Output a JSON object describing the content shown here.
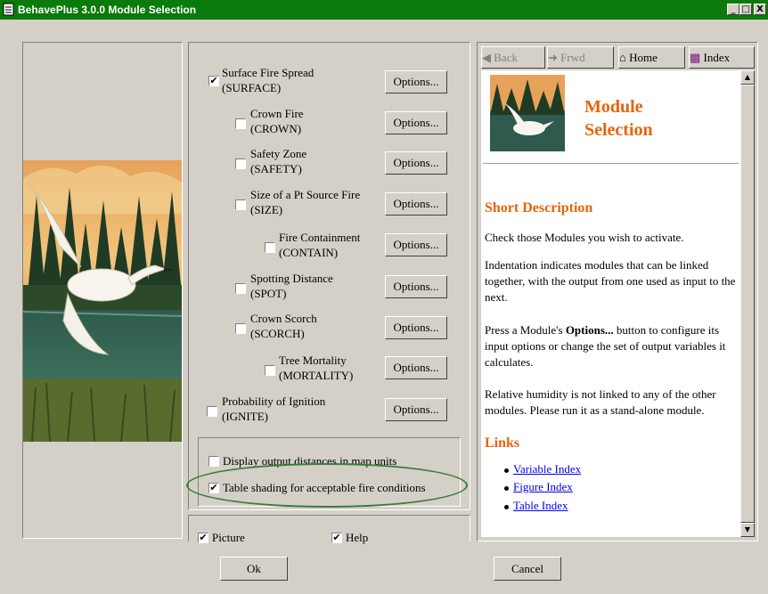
{
  "window": {
    "title": "BehavePlus 3.0.0 Module Selection",
    "controls": [
      "_",
      "□",
      "X"
    ]
  },
  "modules": [
    {
      "name": "Surface Fire Spread",
      "code": "(SURFACE)",
      "checked": true,
      "options_label": "Options..."
    },
    {
      "name": "Crown Fire",
      "code": "(CROWN)",
      "checked": false,
      "options_label": "Options..."
    },
    {
      "name": "Safety Zone",
      "code": "(SAFETY)",
      "checked": false,
      "options_label": "Options..."
    },
    {
      "name": "Size of a Pt Source Fire",
      "code": "(SIZE)",
      "checked": false,
      "options_label": "Options..."
    },
    {
      "name": "Fire Containment",
      "code": "(CONTAIN)",
      "checked": false,
      "options_label": "Options..."
    },
    {
      "name": "Spotting Distance",
      "code": "(SPOT)",
      "checked": false,
      "options_label": "Options..."
    },
    {
      "name": "Crown Scorch",
      "code": "(SCORCH)",
      "checked": false,
      "options_label": "Options..."
    },
    {
      "name": "Tree Mortality",
      "code": "(MORTALITY)",
      "checked": false,
      "options_label": "Options..."
    },
    {
      "name": "Probability of Ignition",
      "code": "(IGNITE)",
      "checked": false,
      "options_label": "Options..."
    }
  ],
  "settings": [
    {
      "label": "Display output distances in map units",
      "checked": false
    },
    {
      "label": "Table shading for acceptable fire conditions",
      "checked": true
    }
  ],
  "view_options": [
    {
      "label": "Picture",
      "checked": true
    },
    {
      "label": "Help",
      "checked": true
    }
  ],
  "help": {
    "nav": {
      "back": "Back",
      "forward": "Frwd",
      "home": "Home",
      "index": "Index"
    },
    "title_line1": "Module",
    "title_line2": "Selection",
    "short_desc_heading": "Short Description",
    "p1": "Check those Modules you wish to activate.",
    "p2": "Indentation indicates modules that can be linked together, with the output from one used as input to the next.",
    "p3_before": "Press a Module's ",
    "p3_bold": "Options...",
    "p3_after": " button to configure its input options or change the set of output variables it calculates.",
    "p4": "Relative humidity is not linked to any of the other modules. Please run it as a stand-alone module.",
    "links_heading": "Links",
    "links": [
      "Variable Index",
      "Figure Index",
      "Table Index"
    ]
  },
  "buttons": {
    "ok": "Ok",
    "cancel": "Cancel"
  },
  "colors": {
    "titlebar": "#0a7a0a",
    "heading": "#e8630a",
    "link": "#0000ee",
    "highlight_oval": "#3f7a3f"
  }
}
